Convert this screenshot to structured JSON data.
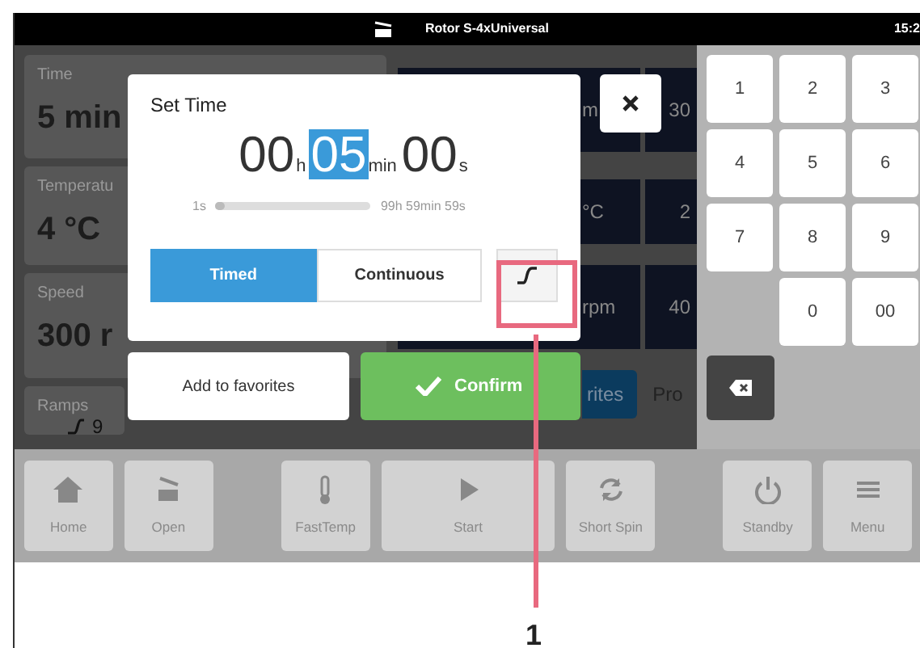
{
  "status_bar": {
    "title": "Rotor S-4xUniversal",
    "time": "15:2"
  },
  "parameters": [
    {
      "label": "Time",
      "value": "5 min"
    },
    {
      "label": "Temperatu",
      "value": "4 °C"
    },
    {
      "label": "Speed",
      "value": "300 r"
    },
    {
      "label": "Ramps",
      "value": "9"
    }
  ],
  "setpoint_rows": [
    {
      "column_1": "m",
      "column_2": "30"
    },
    {
      "column_1": "°C",
      "column_2": "2"
    },
    {
      "column_1": "rpm",
      "column_2": "40"
    }
  ],
  "favorites_button": "rites",
  "programs_tab": "Pro",
  "dialog": {
    "title": "Set Time",
    "segments": [
      {
        "value": "00",
        "unit": "h",
        "selected": false
      },
      {
        "value": "05",
        "unit": "min",
        "selected": true
      },
      {
        "value": "00",
        "unit": "s",
        "selected": false
      }
    ],
    "range": {
      "min": "1s",
      "max": "99h 59min 59s",
      "level": 0.02
    },
    "modes": [
      {
        "label": "Timed",
        "selected": true
      },
      {
        "label": "Continuous",
        "selected": false
      }
    ],
    "buttons": [
      {
        "kind": "secondary",
        "label": "Add to favorites"
      },
      {
        "kind": "confirm",
        "label": "Confirm"
      }
    ]
  },
  "keypad": [
    {
      "kind": "digit",
      "label": "1"
    },
    {
      "kind": "digit",
      "label": "2"
    },
    {
      "kind": "digit",
      "label": "3"
    },
    {
      "kind": "digit",
      "label": "4"
    },
    {
      "kind": "digit",
      "label": "5"
    },
    {
      "kind": "digit",
      "label": "6"
    },
    {
      "kind": "digit",
      "label": "7"
    },
    {
      "kind": "digit",
      "label": "8"
    },
    {
      "kind": "digit",
      "label": "9"
    },
    {
      "kind": "gap"
    },
    {
      "kind": "digit",
      "label": "0"
    },
    {
      "kind": "digit",
      "label": "00"
    }
  ],
  "toolbar": [
    {
      "kind": "home",
      "label": "Home"
    },
    {
      "kind": "open",
      "label": "Open"
    },
    {
      "kind": "spacer"
    },
    {
      "kind": "fasttemp",
      "label": "FastTemp"
    },
    {
      "kind": "start",
      "label": "Start"
    },
    {
      "kind": "shortspin",
      "label": "Short Spin"
    },
    {
      "kind": "spacer"
    },
    {
      "kind": "standby",
      "label": "Standby"
    },
    {
      "kind": "menu",
      "label": "Menu"
    }
  ],
  "callout": {
    "label": "1"
  }
}
